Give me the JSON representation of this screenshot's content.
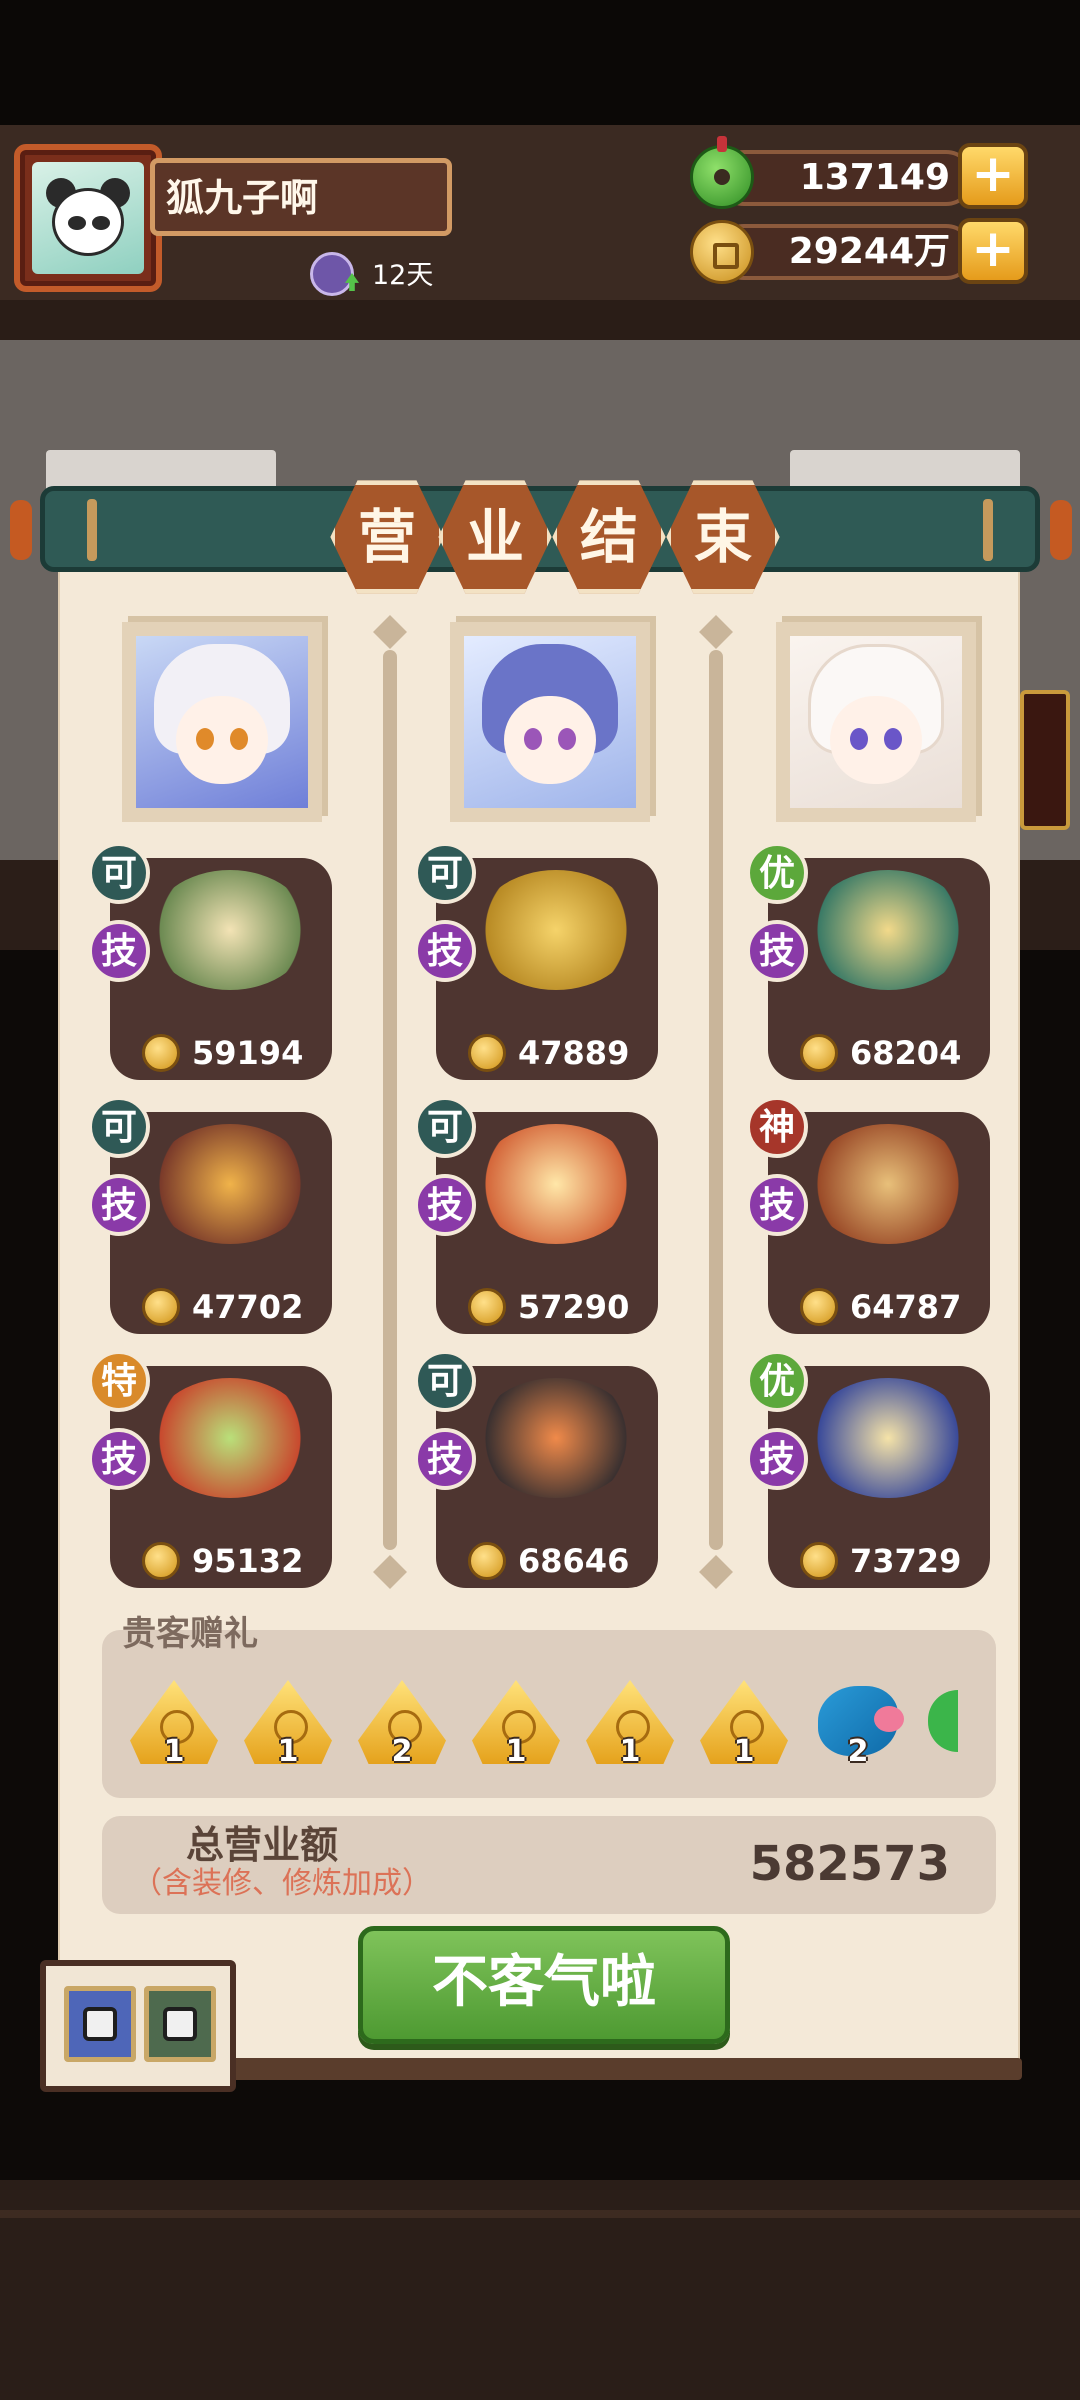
{
  "player": {
    "name": "狐九子啊",
    "days": "12天"
  },
  "resources": {
    "jade": "137149",
    "coins": "29244万"
  },
  "title": [
    "营",
    "业",
    "结",
    "束"
  ],
  "customers": [
    {
      "dishes": [
        {
          "grade": "可",
          "skill": "技",
          "value": "59194"
        },
        {
          "grade": "可",
          "skill": "技",
          "value": "47702"
        },
        {
          "grade": "特",
          "skill": "技",
          "value": "95132"
        }
      ]
    },
    {
      "dishes": [
        {
          "grade": "可",
          "skill": "技",
          "value": "47889"
        },
        {
          "grade": "可",
          "skill": "技",
          "value": "57290"
        },
        {
          "grade": "可",
          "skill": "技",
          "value": "68646"
        }
      ]
    },
    {
      "dishes": [
        {
          "grade": "优",
          "skill": "技",
          "value": "68204"
        },
        {
          "grade": "神",
          "skill": "技",
          "value": "64787"
        },
        {
          "grade": "优",
          "skill": "技",
          "value": "73729"
        }
      ]
    }
  ],
  "gifts": {
    "title": "贵客赠礼",
    "items": [
      {
        "icon": "gold-triangle-swirl-icon",
        "count": "1"
      },
      {
        "icon": "gold-triangle-flame-icon",
        "count": "1"
      },
      {
        "icon": "gold-triangle-flame-icon",
        "count": "2"
      },
      {
        "icon": "gold-triangle-flame-icon",
        "count": "1"
      },
      {
        "icon": "gold-triangle-lattice-icon",
        "count": "1"
      },
      {
        "icon": "gold-triangle-lattice-icon",
        "count": "1"
      },
      {
        "icon": "fish-icon",
        "count": "2"
      },
      {
        "icon": "green-orb-icon",
        "count": ""
      }
    ]
  },
  "total": {
    "label": "总营业额",
    "note": "（含装修、修炼加成）",
    "value": "582573"
  },
  "confirm_label": "不客气啦",
  "plus_symbol": "+",
  "colors": {
    "panel": "#f4e9d8",
    "dish_card": "#4e3530",
    "confirm_green": "#5faa3c",
    "title_tile": "#a7572a"
  }
}
